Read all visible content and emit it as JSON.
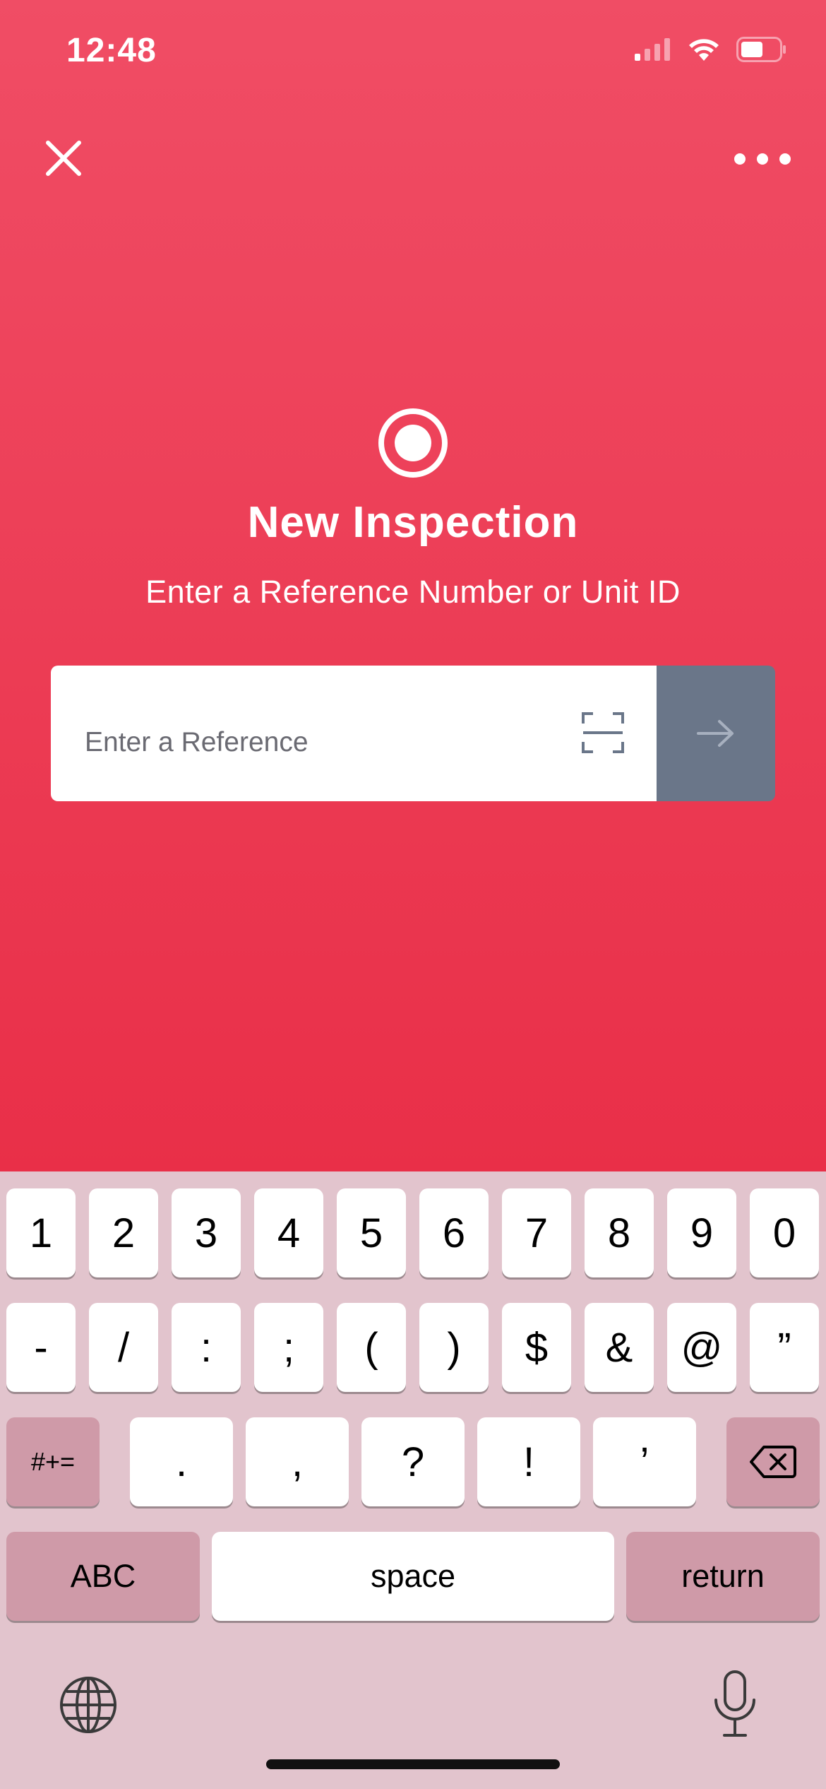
{
  "status": {
    "time": "12:48"
  },
  "header": {
    "close_icon": "close-icon",
    "more_icon": "more-icon"
  },
  "main": {
    "icon": "record-icon",
    "title": "New Inspection",
    "subtitle": "Enter a Reference Number or Unit ID",
    "input": {
      "placeholder": "Enter a Reference",
      "value": ""
    },
    "scan_icon": "scan-icon",
    "submit_icon": "arrow-right-icon"
  },
  "colors": {
    "background_top": "#f04d65",
    "background_bottom": "#e92f48",
    "submit": "#6a7689",
    "keyboard": "#e2c4cd"
  },
  "keyboard": {
    "row1": [
      "1",
      "2",
      "3",
      "4",
      "5",
      "6",
      "7",
      "8",
      "9",
      "0"
    ],
    "row2": [
      "-",
      "/",
      ":",
      ";",
      "(",
      ")",
      "$",
      "&",
      "@",
      "”"
    ],
    "row3": {
      "mode": "#+=",
      "keys": [
        ".",
        ",",
        "?",
        "!",
        "’"
      ]
    },
    "row4": {
      "abc": "ABC",
      "space": "space",
      "return": "return"
    }
  }
}
